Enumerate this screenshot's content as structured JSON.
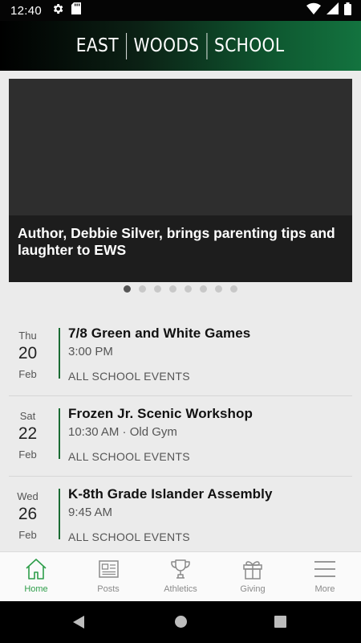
{
  "status_bar": {
    "time": "12:40"
  },
  "header": {
    "logo_words": [
      "EAST",
      "WOODS",
      "SCHOOL"
    ]
  },
  "hero": {
    "caption": "Author, Debbie Silver, brings parenting tips and laughter to EWS",
    "slide_count": 8,
    "active_slide": 1
  },
  "events": [
    {
      "dow": "Thu",
      "day": "20",
      "month": "Feb",
      "title": "7/8 Green and White Games",
      "time": "3:00 PM",
      "category": "ALL SCHOOL EVENTS"
    },
    {
      "dow": "Sat",
      "day": "22",
      "month": "Feb",
      "title": "Frozen Jr. Scenic Workshop",
      "time": "10:30 AM · Old Gym",
      "category": "ALL SCHOOL EVENTS"
    },
    {
      "dow": "Wed",
      "day": "26",
      "month": "Feb",
      "title": "K-8th Grade Islander Assembly",
      "time": "9:45 AM",
      "category": "ALL SCHOOL EVENTS"
    }
  ],
  "bottom_nav": [
    {
      "label": "Home",
      "icon": "home-icon",
      "active": true
    },
    {
      "label": "Posts",
      "icon": "newspaper-icon",
      "active": false
    },
    {
      "label": "Athletics",
      "icon": "trophy-icon",
      "active": false
    },
    {
      "label": "Giving",
      "icon": "gift-icon",
      "active": false
    },
    {
      "label": "More",
      "icon": "menu-icon",
      "active": false
    }
  ],
  "colors": {
    "accent": "#2e9e4a",
    "event_bar": "#1a6b33",
    "header_green": "#13733f"
  }
}
